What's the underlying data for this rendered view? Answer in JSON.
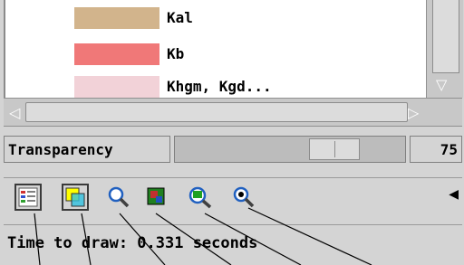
{
  "legend": {
    "items": [
      {
        "label": "Kal",
        "color": "#d2b48c"
      },
      {
        "label": "Kb",
        "color": "#f07878"
      },
      {
        "label": "Khgm, Kgd...",
        "color": "#f2d2d8"
      }
    ]
  },
  "transparency": {
    "label": "Transparency",
    "value": "75",
    "level_percent": 75
  },
  "toolbar": {
    "tools": [
      {
        "icon": "legend-list-icon"
      },
      {
        "icon": "layer-transparency-icon"
      },
      {
        "icon": "zoom-icon"
      },
      {
        "icon": "raster-view-icon"
      },
      {
        "icon": "zoom-to-layer-icon"
      },
      {
        "icon": "find-icon"
      }
    ],
    "collapse_icon": "triangle-left-icon"
  },
  "status": {
    "text": "Time to draw: 0.331 seconds"
  },
  "colors": {
    "panel": "#d4d4d4",
    "highlight_yellow": "#ffff00"
  }
}
